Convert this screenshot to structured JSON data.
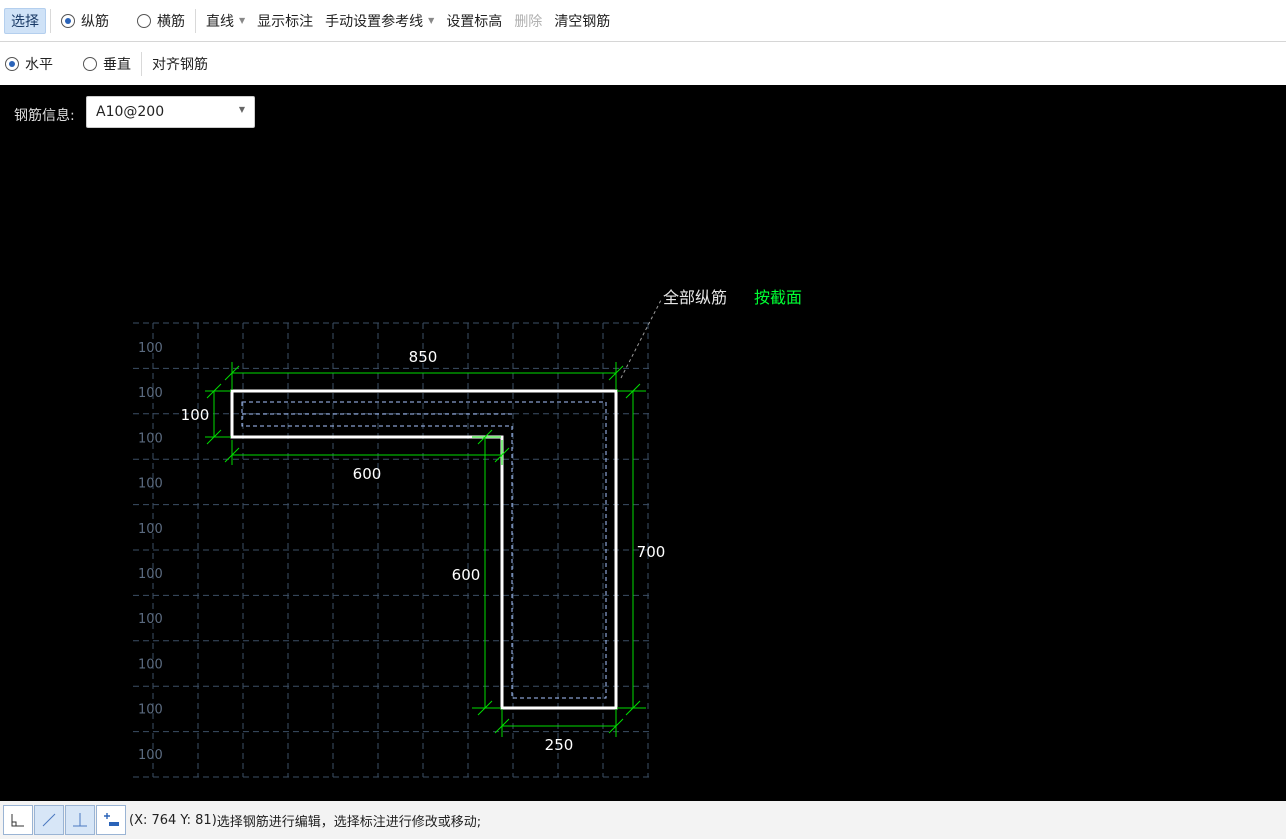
{
  "toolbar": {
    "select_label": "选择",
    "longitudinal_label": "纵筋",
    "transverse_label": "横筋",
    "line_mode_label": "直线",
    "show_dimension_label": "显示标注",
    "manual_reference_label": "手动设置参考线",
    "set_elevation_label": "设置标高",
    "delete_label": "删除",
    "clear_rebar_label": "清空钢筋",
    "selected_rebar_type": "纵筋"
  },
  "toolbar2": {
    "horizontal_label": "水平",
    "vertical_label": "垂直",
    "align_rebar_label": "对齐钢筋",
    "selected_orientation": "水平"
  },
  "rebar_info": {
    "label": "钢筋信息:",
    "value": "A10@200"
  },
  "drawing": {
    "annotation_all_longitudinal": "全部纵筋",
    "annotation_by_section": "按截面",
    "grid_row_labels": [
      "100",
      "100",
      "100",
      "100",
      "100",
      "100",
      "100",
      "100",
      "100",
      "100"
    ],
    "dimensions": {
      "top_width": "850",
      "flange_thickness": "100",
      "flange_inner_length": "600",
      "web_inner_height": "600",
      "total_height": "700",
      "web_width": "250"
    },
    "colors": {
      "background": "#000000",
      "outline": "#ffffff",
      "dimension": "#00dd00",
      "rebar": "#a8c4ff",
      "grid": "#3c4f66",
      "highlight_text": "#00ff33"
    }
  },
  "status": {
    "coords": "(X: 764 Y: 81)",
    "message": "选择钢筋进行编辑，选择标注进行修改或移动;",
    "tools": [
      "corner-tool",
      "diagonal-line-tool",
      "perpendicular-tool",
      "add-point-tool"
    ]
  }
}
